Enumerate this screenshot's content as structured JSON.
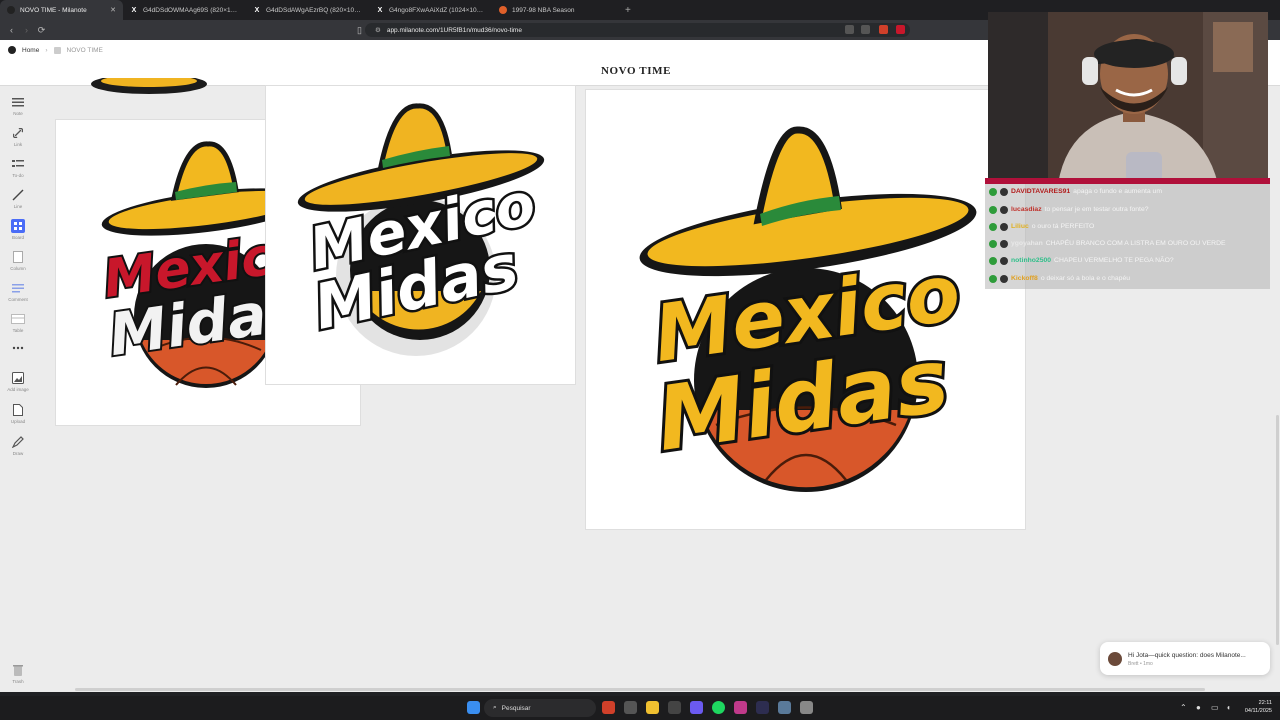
{
  "browser": {
    "tabs": [
      {
        "title": "NOVO TIME - Milanote",
        "favicon": "milanote-icon",
        "active": true
      },
      {
        "title": "G4dDSdOWMAAg69S (820×1024)",
        "favicon": "x-icon",
        "active": false
      },
      {
        "title": "G4dDSdAWgAEzrBQ (820×1024)",
        "favicon": "x-icon",
        "active": false
      },
      {
        "title": "G4ngo8FXwAAiXdZ (1024×1024)",
        "favicon": "x-icon",
        "active": false
      },
      {
        "title": "1997-98 NBA Season",
        "favicon": "basketball-icon",
        "active": false
      }
    ],
    "url": "app.milanote.com/1UR5fB1n/mud36/novo-time"
  },
  "app": {
    "breadcrumb": {
      "home": "Home",
      "current": "NOVO TIME"
    },
    "board_title": "NOVO TIME",
    "sidebar_tools": [
      {
        "label": "Note",
        "icon": "note-icon"
      },
      {
        "label": "Link",
        "icon": "link-icon"
      },
      {
        "label": "To-do",
        "icon": "todo-icon"
      },
      {
        "label": "Line",
        "icon": "line-icon"
      },
      {
        "label": "Board",
        "icon": "board-icon"
      },
      {
        "label": "Column",
        "icon": "column-icon"
      },
      {
        "label": "Comment",
        "icon": "comment-icon"
      },
      {
        "label": "Table",
        "icon": "table-icon"
      },
      {
        "label": "",
        "icon": "more-icon"
      },
      {
        "label": "Add image",
        "icon": "image-icon"
      },
      {
        "label": "Upload",
        "icon": "upload-icon"
      },
      {
        "label": "Draw",
        "icon": "draw-icon"
      },
      {
        "label": "Trash",
        "icon": "trash-icon"
      }
    ],
    "logos": [
      {
        "line1": "Mexico",
        "line2": "Midas",
        "style": "red-white"
      },
      {
        "line1": "Mexico",
        "line2": "Midas",
        "style": "white"
      },
      {
        "line1": "Mexico",
        "line2": "Midas",
        "style": "gold"
      }
    ],
    "toast": {
      "message": "Hi Jota—quick question: does Milanote...",
      "meta": "Brett • 1mo"
    }
  },
  "stream_chat": {
    "lines": [
      {
        "user": "DAVIDTAVARES91",
        "text": "apaga o fundo e aumenta um",
        "color": "#b21c1c"
      },
      {
        "user": "lucasdiaz",
        "text": "to pensar je em testar outra fonte?",
        "color": "#c0302a"
      },
      {
        "user": "Liliuc",
        "text": "o ouro tá PERFEITO",
        "color": "#e0b020"
      },
      {
        "user": "ygoyahan",
        "text": "CHAPÉU BRANCO COM A LISTRA EM OURO OU VERDE",
        "color": "#e8e8e8"
      },
      {
        "user": "notinho2500",
        "text": "CHAPEU VERMELHO TE PEGA NÃO?",
        "color": "#2fbf8a"
      },
      {
        "user": "Kickoff8",
        "text": "o deixar só a bola e o chapéu",
        "color": "#e0a020"
      }
    ]
  },
  "taskbar": {
    "search_placeholder": "Pesquisar",
    "time": "22:11",
    "date": "04/11/2025"
  },
  "colors": {
    "accent": "#4a6cf7",
    "gold": "#f2b81f",
    "red": "#c8172b",
    "hat_green": "#2a8a3a",
    "ball": "#d8572a"
  }
}
